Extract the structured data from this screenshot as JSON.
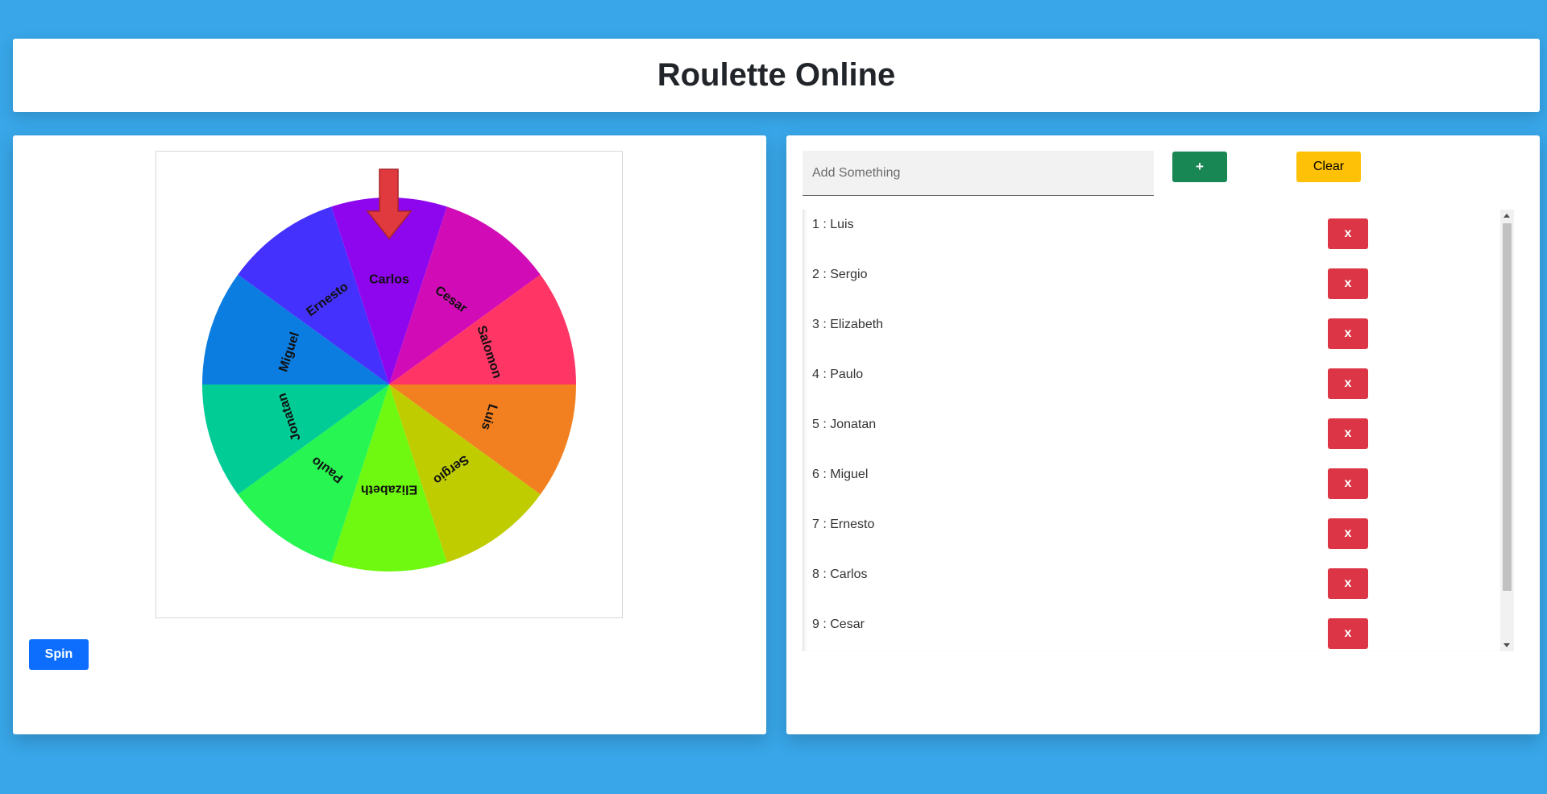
{
  "header": {
    "title": "Roulette Online"
  },
  "wheel": {
    "segments": [
      {
        "name": "Luis",
        "color": "#f28020"
      },
      {
        "name": "Sergio",
        "color": "#bfcc00"
      },
      {
        "name": "Elizabeth",
        "color": "#6ff910"
      },
      {
        "name": "Paulo",
        "color": "#26f552"
      },
      {
        "name": "Jonatan",
        "color": "#02cc96"
      },
      {
        "name": "Miguel",
        "color": "#0c7de0"
      },
      {
        "name": "Ernesto",
        "color": "#4431fe"
      },
      {
        "name": "Carlos",
        "color": "#8e06ed"
      },
      {
        "name": "Cesar",
        "color": "#d10bb5"
      },
      {
        "name": "Salomon",
        "color": "#ff3566"
      }
    ],
    "pointer_color": "#e03a3e"
  },
  "controls": {
    "spin_label": "Spin",
    "add_placeholder": "Add Something",
    "add_label": "+",
    "clear_label": "Clear",
    "delete_label": "x"
  },
  "list": {
    "items": [
      "1 : Luis",
      "2 : Sergio",
      "3 : Elizabeth",
      "4 : Paulo",
      "5 : Jonatan",
      "6 : Miguel",
      "7 : Ernesto",
      "8 : Carlos",
      "9 : Cesar"
    ]
  }
}
